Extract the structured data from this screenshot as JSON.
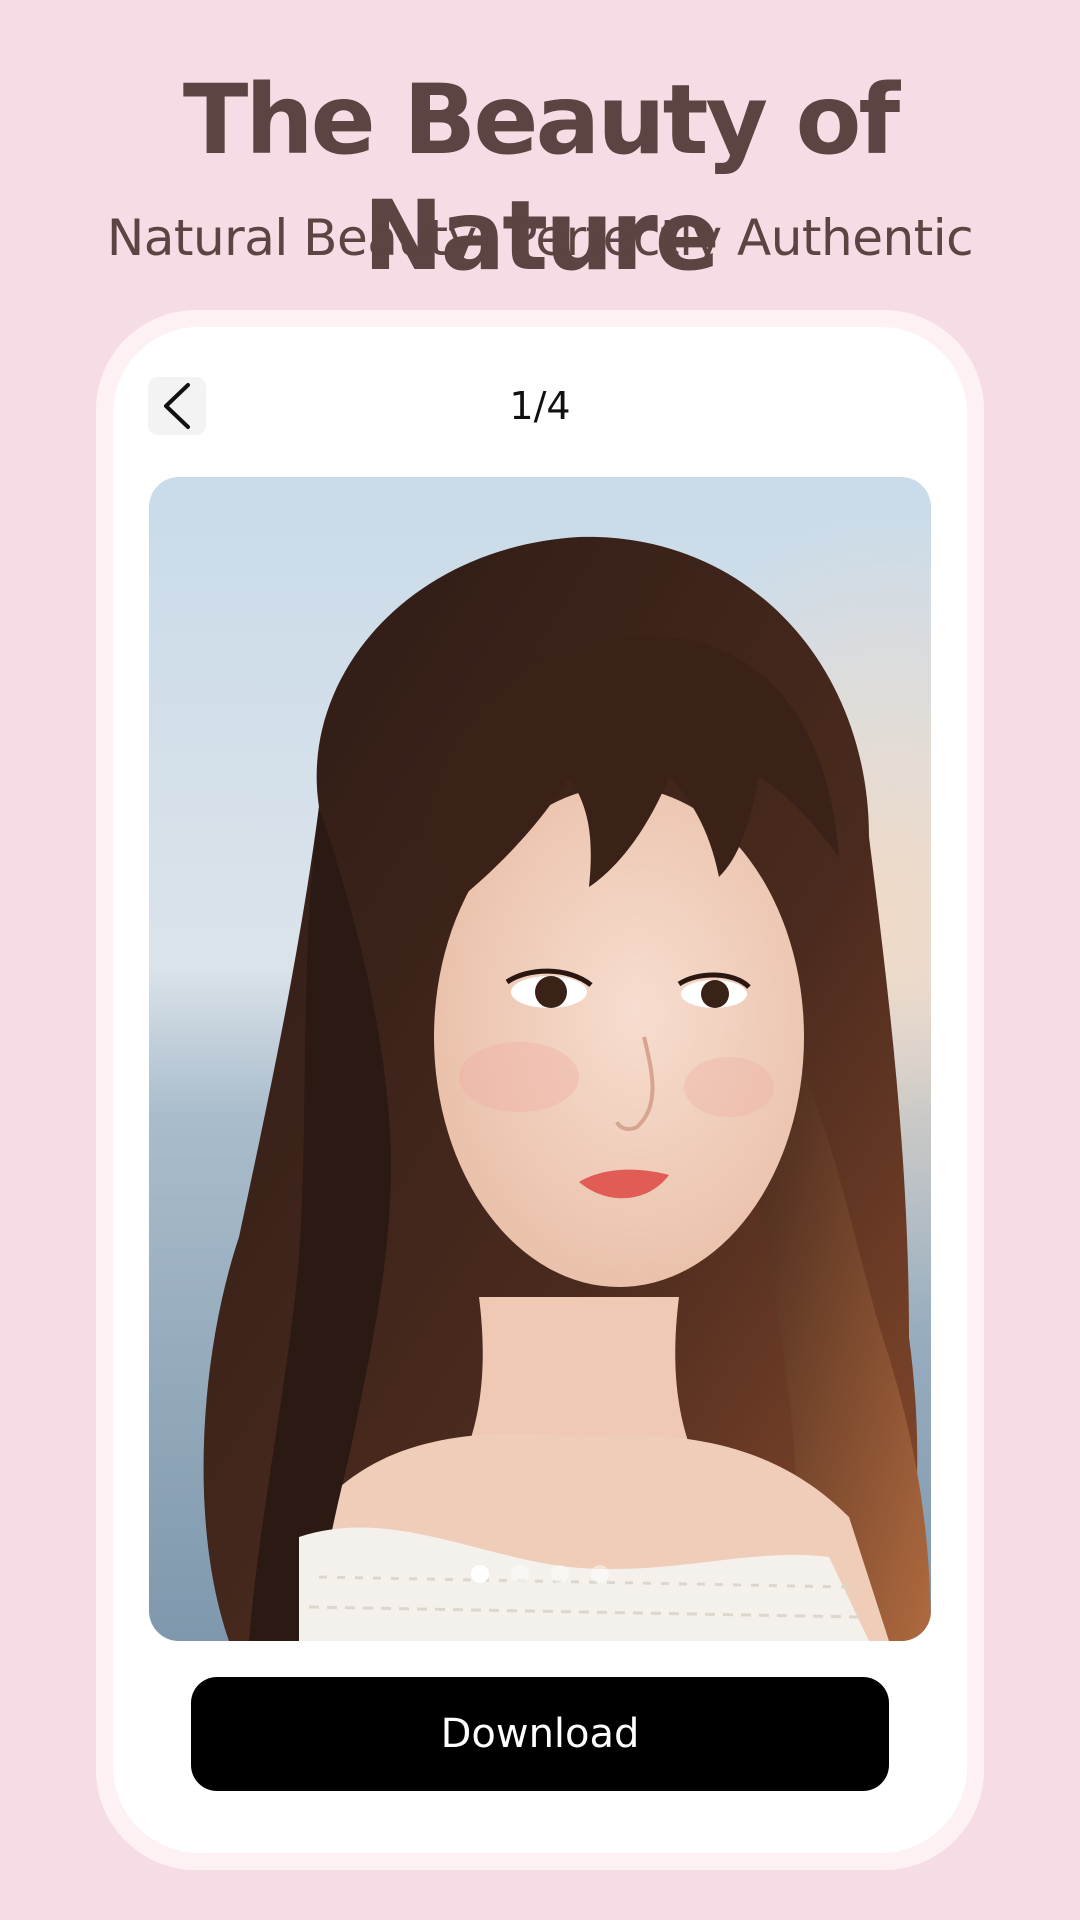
{
  "header": {
    "title": "The Beauty of Nature",
    "subtitle": "Natural Beauty, Perfectly Authentic"
  },
  "viewer": {
    "back_icon": "chevron-left-icon",
    "page_counter": "1/4",
    "current_page": 1,
    "total_pages": 4,
    "photo_description": "portrait photo of a young woman with long wavy brown hair and bangs, off-shoulder white knit sweater, sea and sky background"
  },
  "actions": {
    "download_label": "Download"
  },
  "colors": {
    "background": "#f6dce5",
    "title_text": "#5b4441",
    "button_bg": "#000000",
    "button_text": "#ffffff"
  }
}
